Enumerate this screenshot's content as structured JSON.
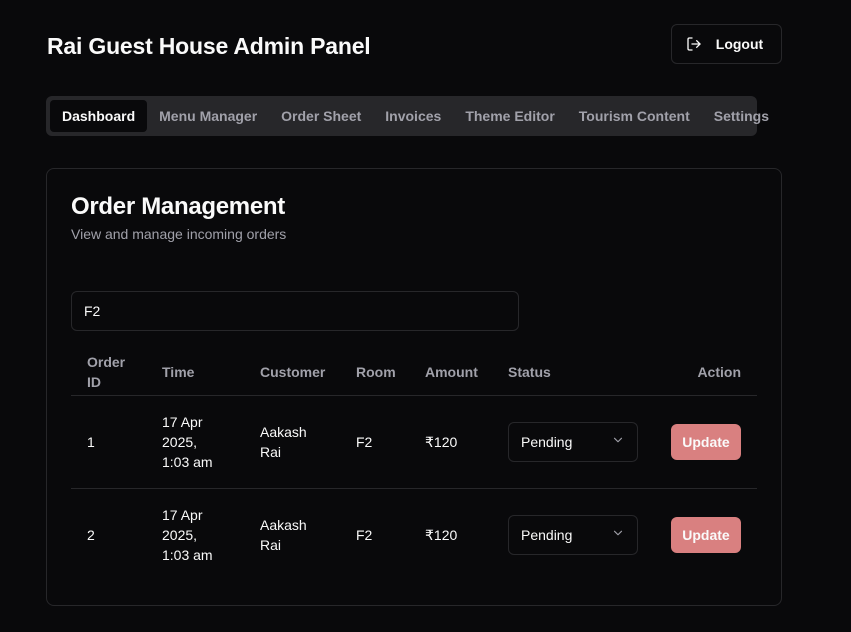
{
  "header": {
    "title": "Rai Guest House Admin Panel",
    "logout_label": "Logout",
    "logout_icon": "logout-icon"
  },
  "tabs": [
    {
      "label": "Dashboard",
      "active": true
    },
    {
      "label": "Menu Manager",
      "active": false
    },
    {
      "label": "Order Sheet",
      "active": false
    },
    {
      "label": "Invoices",
      "active": false
    },
    {
      "label": "Theme Editor",
      "active": false
    },
    {
      "label": "Tourism Content",
      "active": false
    },
    {
      "label": "Settings",
      "active": false
    }
  ],
  "orders": {
    "title": "Order Management",
    "description": "View and manage incoming orders",
    "search_value": "F2",
    "columns": [
      "Order ID",
      "Time",
      "Customer",
      "Room",
      "Amount",
      "Status",
      "Action"
    ],
    "rows": [
      {
        "id": "1",
        "time": "17 Apr 2025, 1:03 am",
        "customer": "Aakash Rai",
        "room": "F2",
        "amount": "₹120",
        "status": "Pending",
        "action": "Update"
      },
      {
        "id": "2",
        "time": "17 Apr 2025, 1:03 am",
        "customer": "Aakash Rai",
        "room": "F2",
        "amount": "₹120",
        "status": "Pending",
        "action": "Update"
      }
    ]
  },
  "colors": {
    "background": "#09090b",
    "muted_surface": "#27272a",
    "muted_text": "#a1a1aa",
    "update_button": "#d98080"
  }
}
